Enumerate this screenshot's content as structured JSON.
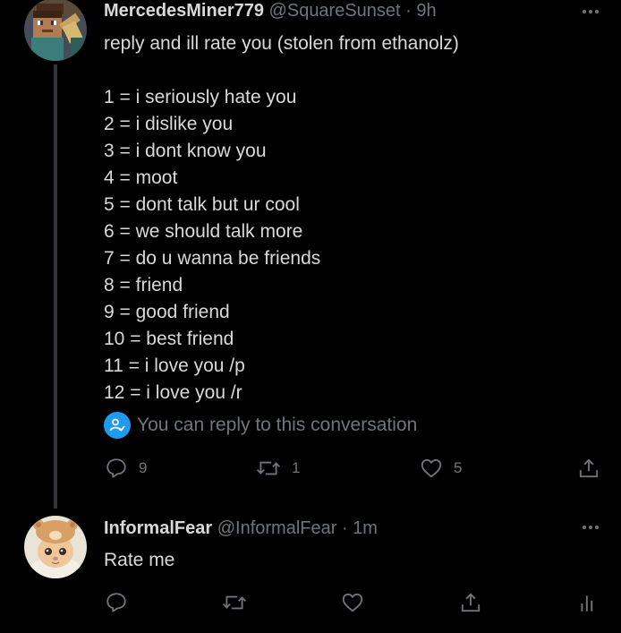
{
  "tweets": [
    {
      "display_name": "MercedesMiner779",
      "handle": "@SquareSunset",
      "separator": "·",
      "time": "9h",
      "lines": [
        "reply and ill rate you (stolen from ethanolz)",
        "",
        "1 = i seriously hate you",
        "2 = i dislike you",
        "3 = i dont know you",
        "4 = moot",
        "5 = dont talk but ur cool",
        "6 = we should talk more",
        "7 = do u wanna be friends",
        "8 = friend",
        "9 = good friend",
        "10 = best friend",
        "11 = i love you /p",
        "12 = i love you /r"
      ],
      "reply_note": "You can reply to this conversation",
      "reply_count": "9",
      "retweet_count": "1",
      "like_count": "5",
      "icons": {
        "more": "more-icon",
        "reply_note": "mention-user-icon",
        "reply": "reply-icon",
        "retweet": "retweet-icon",
        "like": "heart-icon",
        "share": "share-icon"
      }
    },
    {
      "display_name": "InformalFear",
      "handle": "@InformalFear",
      "separator": "·",
      "time": "1m",
      "lines": [
        "Rate me"
      ],
      "icons": {
        "more": "more-icon",
        "reply": "reply-icon",
        "retweet": "retweet-icon",
        "like": "heart-icon",
        "share": "share-icon",
        "analytics": "analytics-icon"
      }
    }
  ],
  "colors": {
    "background": "#000000",
    "text": "#d9d9d9",
    "secondary": "#6e767d",
    "accent": "#1d9bf0",
    "thread_line": "#333639"
  }
}
